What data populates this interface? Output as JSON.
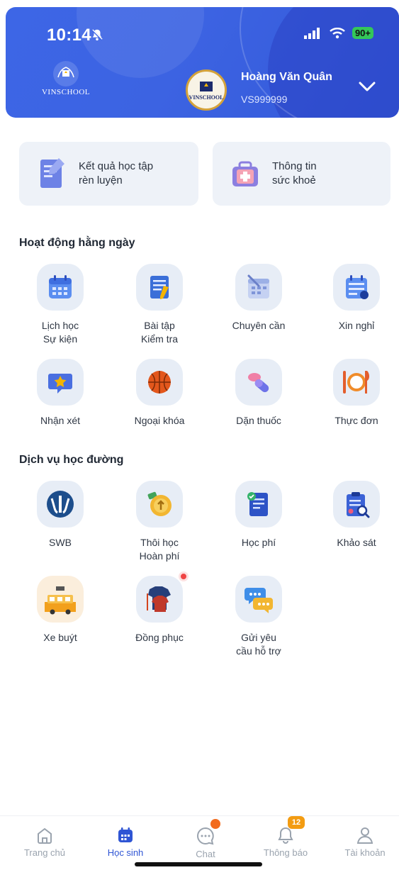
{
  "status_bar": {
    "time": "10:14",
    "battery": "90+"
  },
  "header": {
    "logo_text": "VINSCHOOL",
    "avatar_text": "VINSCHOOL",
    "user_name": "Hoàng Văn Quân",
    "user_id": "VS999999"
  },
  "quick_cards": [
    {
      "label": "Kết quả học tập\nrèn luyện",
      "icon": "report-document-icon"
    },
    {
      "label": "Thông tin\nsức khoẻ",
      "icon": "medical-kit-icon"
    }
  ],
  "daily": {
    "title": "Hoạt động hằng ngày",
    "items": [
      {
        "label": "Lịch học\nSự kiện",
        "icon": "calendar-icon"
      },
      {
        "label": "Bài tập\nKiểm tra",
        "icon": "homework-icon"
      },
      {
        "label": "Chuyên cần",
        "icon": "attendance-icon"
      },
      {
        "label": "Xin nghỉ",
        "icon": "leave-request-icon"
      },
      {
        "label": "Nhận xét",
        "icon": "comment-star-icon"
      },
      {
        "label": "Ngoại khóa",
        "icon": "basketball-icon"
      },
      {
        "label": "Dặn thuốc",
        "icon": "pill-icon"
      },
      {
        "label": "Thực đơn",
        "icon": "meal-plate-icon"
      }
    ]
  },
  "services": {
    "title": "Dịch vụ học đường",
    "items": [
      {
        "label": "SWB",
        "icon": "swb-logo-icon"
      },
      {
        "label": "Thôi học\nHoàn phí",
        "icon": "refund-coin-icon"
      },
      {
        "label": "Học phí",
        "icon": "tuition-invoice-icon"
      },
      {
        "label": "Khảo sát",
        "icon": "survey-clipboard-icon"
      },
      {
        "label": "Xe buýt",
        "icon": "school-bus-icon"
      },
      {
        "label": "Đồng phục",
        "icon": "uniform-shirt-icon"
      },
      {
        "label": "Gửi yêu\ncầu hỗ trợ",
        "icon": "support-chat-icon"
      }
    ]
  },
  "bottom_nav": [
    {
      "label": "Trang chủ",
      "icon": "home-icon"
    },
    {
      "label": "Học sinh",
      "icon": "student-calendar-icon",
      "active": true
    },
    {
      "label": "Chat",
      "icon": "chat-bubble-icon"
    },
    {
      "label": "Thông báo",
      "icon": "bell-icon",
      "badge": "12"
    },
    {
      "label": "Tài khoản",
      "icon": "user-account-icon"
    }
  ],
  "colors": {
    "primary": "#3d66e6",
    "active_nav": "#2f55d4",
    "badge": "#f39c12",
    "dot": "#f26b1d"
  }
}
